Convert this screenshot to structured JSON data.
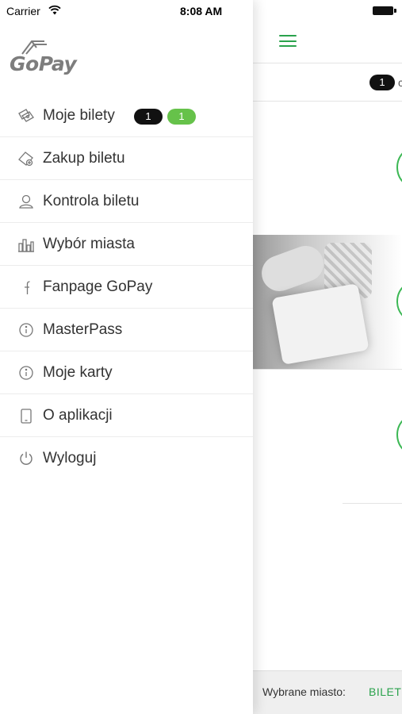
{
  "status_bar": {
    "carrier": "Carrier",
    "time": "8:08 AM",
    "wifi_icon": "wifi-icon",
    "battery_icon": "battery-icon"
  },
  "drawer": {
    "logo_text": "GoPay",
    "logo_icon": "ticket-logo-icon",
    "menu": [
      {
        "label": "Moje bilety",
        "icon": "tickets-icon",
        "badges": [
          "1",
          "1"
        ]
      },
      {
        "label": "Zakup biletu",
        "icon": "ticket-add-icon"
      },
      {
        "label": "Kontrola biletu",
        "icon": "inspector-icon"
      },
      {
        "label": "Wybór miasta",
        "icon": "city-icon"
      },
      {
        "label": "Fanpage GoPay",
        "icon": "facebook-icon"
      },
      {
        "label": "MasterPass",
        "icon": "info-icon"
      },
      {
        "label": "Moje karty",
        "icon": "info-icon"
      },
      {
        "label": "O aplikacji",
        "icon": "phone-icon"
      },
      {
        "label": "Wyloguj",
        "icon": "power-icon"
      }
    ]
  },
  "main": {
    "menu_icon": "hamburger-icon",
    "subbar_badge": "1",
    "subbar_extra": "c",
    "bottom_bar": {
      "label": "Wybrane miasto:",
      "value": "BILET"
    }
  },
  "colors": {
    "accent_green": "#2aa24c",
    "badge_green": "#66c24a",
    "badge_black": "#111111",
    "logo_gray": "#7d7d7d"
  }
}
